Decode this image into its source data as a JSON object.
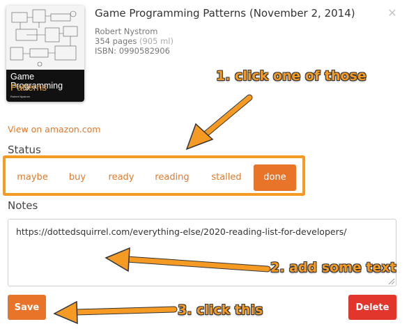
{
  "book": {
    "title": "Game Programming Patterns (November 2, 2014)",
    "author": "Robert Nystrom",
    "pages": "354 pages",
    "pages_ml": "(905 ml)",
    "isbn": "ISBN: 0990582906",
    "cover": {
      "title": "Game Programming",
      "subtitle": "Patterns",
      "author": "Robert Nystrom"
    }
  },
  "links": {
    "amazon": "View on amazon.com"
  },
  "status": {
    "label": "Status",
    "options": [
      "maybe",
      "buy",
      "ready",
      "reading",
      "stalled",
      "done"
    ],
    "selected": "done"
  },
  "notes": {
    "label": "Notes",
    "value": "https://dottedsquirrel.com/everything-else/2020-reading-list-for-developers/"
  },
  "actions": {
    "save": "Save",
    "delete": "Delete"
  },
  "annotations": {
    "step1": "1. click one of those",
    "step2": "2. add some text",
    "step3": "3. click this"
  },
  "icons": {
    "close": "close-icon"
  },
  "colors": {
    "accent": "#e8742a",
    "link": "#e07a2d",
    "delete": "#e2362c",
    "annotation": "#f59a23"
  }
}
